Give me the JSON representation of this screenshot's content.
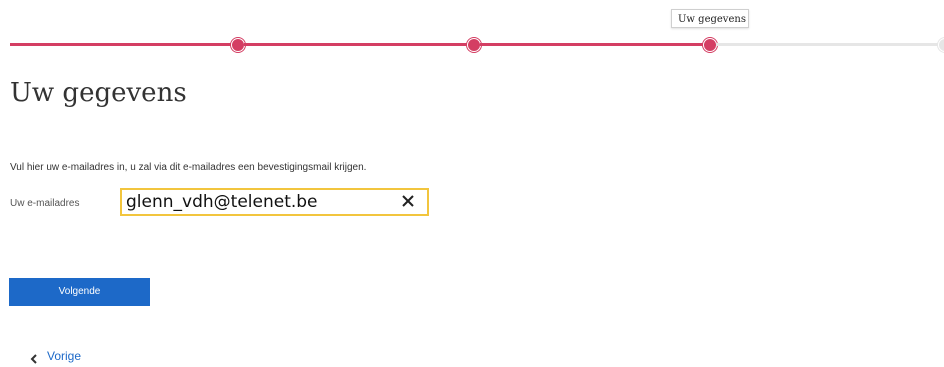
{
  "stepper": {
    "active_step_tooltip": "Uw gegevens",
    "steps_completed": 3,
    "steps_total": 4,
    "colors": {
      "completed": "#d43e63",
      "pending": "#e6e6e6"
    }
  },
  "page": {
    "title": "Uw gegevens",
    "instructions": "Vul hier uw e-mailadres in, u zal via dit e-mailadres een bevestigingsmail krijgen."
  },
  "email": {
    "label": "Uw e-mailadres",
    "value": "glenn_vdh@telenet.be",
    "clear_icon": "close-icon",
    "focus_color": "#f2c53d"
  },
  "actions": {
    "next_label": "Volgende",
    "next_color": "#1d69c8",
    "prev_label": "Vorige",
    "prev_icon": "chevron-left-icon"
  }
}
